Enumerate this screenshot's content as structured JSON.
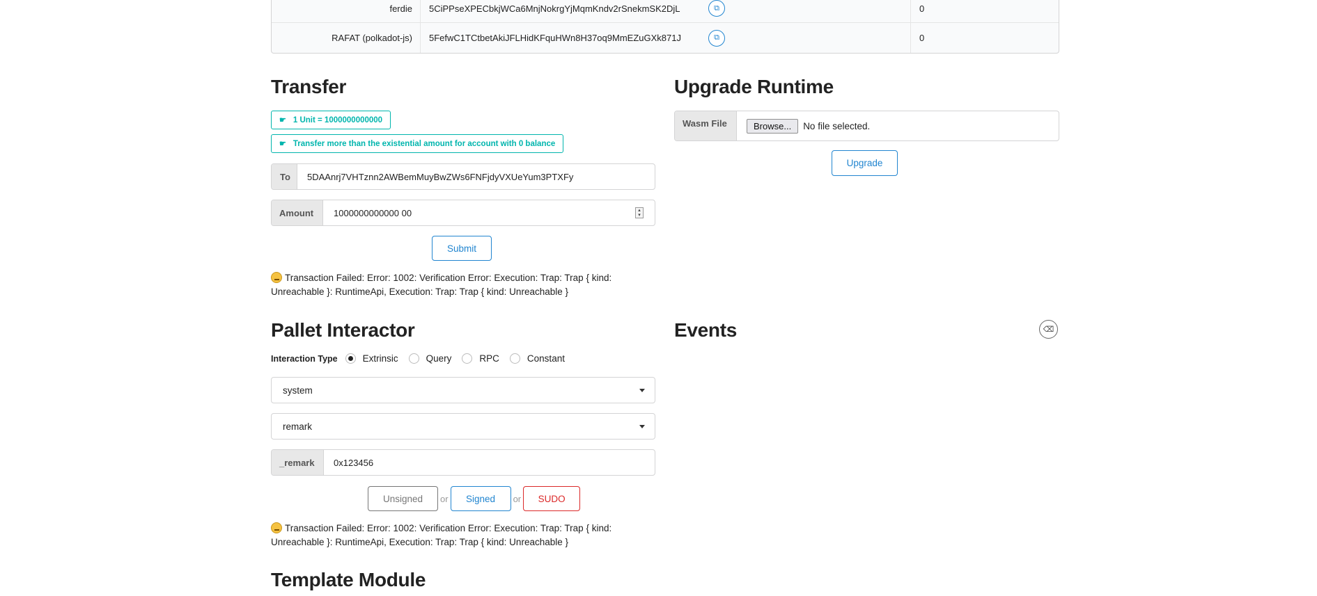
{
  "accounts": [
    {
      "name": "ferdie",
      "address": "5CiPPseXPECbkjWCa6MnjNokrgYjMqmKndv2rSnekmSK2DjL",
      "balance": "0"
    },
    {
      "name": "RAFAT (polkadot-js)",
      "address": "5FefwC1TCtbetAkiJFLHidKFquHWn8H37oq9MmEZuGXk871J",
      "balance": "0"
    }
  ],
  "transfer": {
    "title": "Transfer",
    "info_unit": "1 Unit = 1000000000000",
    "info_existential": "Transfer more than the existential amount for account with 0 balance",
    "to_label": "To",
    "to_value": "5DAAnrj7VHTznn2AWBemMuyBwZWs6FNFjdyVXUeYum3PTXFy",
    "amount_label": "Amount",
    "amount_value": "1000000000000 00",
    "submit_label": "Submit",
    "status": "Transaction Failed: Error: 1002: Verification Error: Execution: Trap: Trap { kind: Unreachable }: RuntimeApi, Execution: Trap: Trap { kind: Unreachable }"
  },
  "upgrade": {
    "title": "Upgrade Runtime",
    "file_label": "Wasm File",
    "browse_label": "Browse...",
    "file_status": "No file selected.",
    "button_label": "Upgrade"
  },
  "pallet": {
    "title": "Pallet Interactor",
    "interaction_label": "Interaction Type",
    "options": [
      "Extrinsic",
      "Query",
      "RPC",
      "Constant"
    ],
    "selected_option": "Extrinsic",
    "pallet_value": "system",
    "callable_value": "remark",
    "param_label": "_remark",
    "param_value": "0x123456",
    "unsigned_label": "Unsigned",
    "or_label": "or",
    "signed_label": "Signed",
    "sudo_label": "SUDO",
    "status": "Transaction Failed: Error: 1002: Verification Error: Execution: Trap: Trap { kind: Unreachable }: RuntimeApi, Execution: Trap: Trap { kind: Unreachable }"
  },
  "events": {
    "title": "Events"
  },
  "template": {
    "title": "Template Module"
  },
  "colors": {
    "teal": "#00b5ad",
    "blue": "#2185d0",
    "red": "#db2828"
  }
}
